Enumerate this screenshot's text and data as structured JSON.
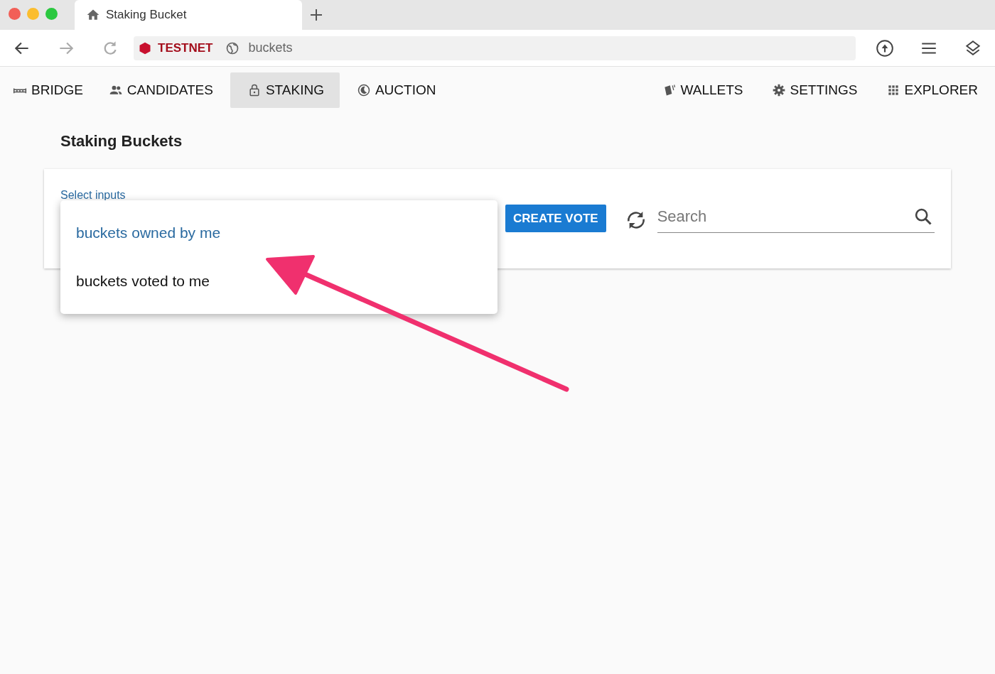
{
  "browser": {
    "tab_title": "Staking Bucket",
    "network_badge": "TESTNET",
    "address": "buckets"
  },
  "nav": {
    "left_items": [
      {
        "label": "BRIDGE",
        "kind": "bridge",
        "selected": false
      },
      {
        "label": "CANDIDATES",
        "kind": "people",
        "selected": false
      },
      {
        "label": "STAKING",
        "kind": "lock",
        "selected": true
      },
      {
        "label": "AUCTION",
        "kind": "auction",
        "selected": false
      }
    ],
    "right_items": [
      {
        "label": "WALLETS",
        "kind": "wallet",
        "selected": false
      },
      {
        "label": "SETTINGS",
        "kind": "gear",
        "selected": false
      },
      {
        "label": "EXPLORER",
        "kind": "grid",
        "selected": false
      }
    ]
  },
  "page_title": "Staking Buckets",
  "select": {
    "label": "Select inputs",
    "options": [
      {
        "label": "buckets owned by me",
        "selected": true
      },
      {
        "label": "buckets voted to me",
        "selected": false
      }
    ]
  },
  "create_button": "CREATE VOTE",
  "search": {
    "placeholder": "Search"
  }
}
